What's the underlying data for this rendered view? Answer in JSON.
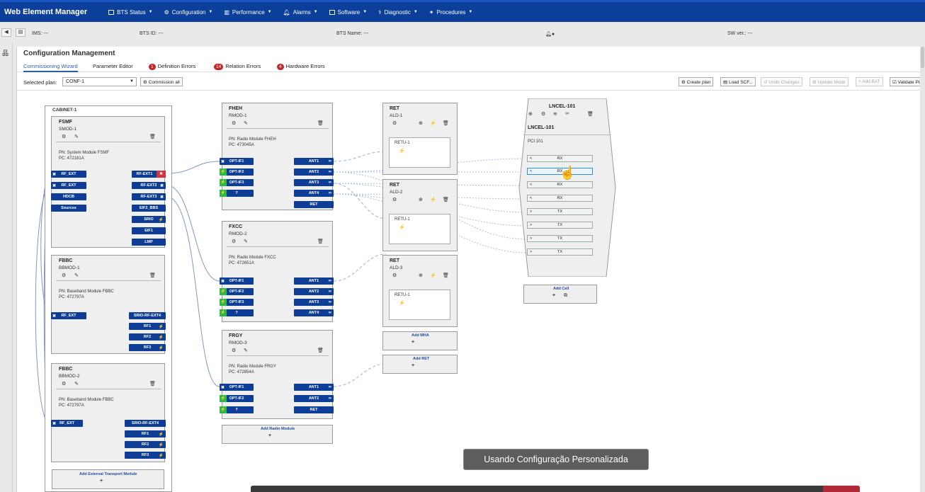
{
  "app": {
    "title": "Web Element Manager"
  },
  "menu": [
    {
      "label": "BTS Status",
      "icon": "bars-icon"
    },
    {
      "label": "Configuration",
      "icon": "gear-icon"
    },
    {
      "label": "Performance",
      "icon": "chart-icon"
    },
    {
      "label": "Alarms",
      "icon": "bell-icon"
    },
    {
      "label": "Software",
      "icon": "drive-icon"
    },
    {
      "label": "Diagnostic",
      "icon": "stethoscope-icon"
    },
    {
      "label": "Procedures",
      "icon": "wrench-icon"
    }
  ],
  "info": {
    "ims": "IMS: ---",
    "bts_id": "BTS ID: ---",
    "bts_name": "BTS Name: ---",
    "sw_ver": "SW ver.: ---"
  },
  "page": {
    "title": "Configuration Management"
  },
  "tabs": {
    "wizard": "Commissioning Wizard",
    "param": "Parameter Editor",
    "def_count": "1",
    "def": "Definition Errors",
    "rel_count": "14",
    "rel": "Relation Errors",
    "hw_count": "4",
    "hw": "Hardware Errors"
  },
  "plan": {
    "label": "Selected plan:",
    "value": "CONF-1",
    "commission": "Commission all",
    "create": "Create plan",
    "load": "Load SCF...",
    "undo": "Undo Changes",
    "update": "Update Mode",
    "add_bat": "+ Add BAT",
    "validate": "Validate Plan"
  },
  "cabinet": {
    "label": "CABINET-1",
    "fsmf": {
      "title": "FSMF",
      "id": "SMOD-1",
      "pn": "PN:   System Module FSMF",
      "pc": "PC:   472181A",
      "left_ports": [
        "RF_EXT",
        "RF_EXT",
        "HDCB",
        "Sources"
      ],
      "right_ports": [
        "RF-EXT1",
        "RF-EXT2",
        "RF-EXT3",
        "EIF2_BBS",
        "SRIO",
        "EIF1",
        "LMP"
      ]
    },
    "fbbc1": {
      "title": "FBBC",
      "id": "BBMOD-1",
      "pn": "PN:   Baseband Module FBBC",
      "pc": "PC:   472797A",
      "left_ports": [
        "RF_EXT"
      ],
      "right_ports": [
        "SRIO-RF-EXT4",
        "RF1",
        "RF2",
        "RF3"
      ]
    },
    "fbbc2": {
      "title": "FBBC",
      "id": "BBMOD-2",
      "pn": "PN:   Baseband Module FBBC",
      "pc": "PC:   472797A",
      "left_ports": [
        "RF_EXT"
      ],
      "right_ports": [
        "SRIO-RF-EXT4",
        "RF1",
        "RF2",
        "RF3"
      ]
    },
    "add_transport": "Add External Transport Module"
  },
  "radios": [
    {
      "title": "FHEH",
      "id": "RMOD-1",
      "pn": "PN:   Radio Module FHEH",
      "pc": "PC:   473045A",
      "left": [
        "OPT-IF1",
        "OPT-IF2",
        "OPT-IF3",
        "?"
      ],
      "right": [
        "ANT1",
        "ANT2",
        "ANT3",
        "ANT4",
        "RET"
      ]
    },
    {
      "title": "FXCC",
      "id": "RMOD-2",
      "pn": "PN:   Radio Module FXCC",
      "pc": "PC:   472651A",
      "left": [
        "OPT-IF1",
        "OPT-IF2",
        "OPT-IF3",
        "?"
      ],
      "right": [
        "ANT1",
        "ANT2",
        "ANT3",
        "ANT4"
      ]
    },
    {
      "title": "FRGY",
      "id": "RMOD-3",
      "pn": "PN:   Radio Module FRGY",
      "pc": "PC:   472854A",
      "left": [
        "OPT-IF1",
        "OPT-IF2",
        "?"
      ],
      "right": [
        "ANT1",
        "ANT2",
        "RET"
      ]
    }
  ],
  "add_radio": "Add Radio Module",
  "rets": [
    {
      "title": "RET",
      "id": "ALD-1",
      "unit": "RETU-1"
    },
    {
      "title": "RET",
      "id": "ALD-2",
      "unit": "RETU-1"
    },
    {
      "title": "RET",
      "id": "ALD-3",
      "unit": "RETU-1"
    }
  ],
  "add_mha": "Add MHA",
  "add_ret": "Add RET",
  "cell": {
    "title": "LNCEL-101",
    "name": "LNCEL-101",
    "pci": "PCI 101",
    "ports": [
      "RX",
      "RX",
      "RX",
      "RX",
      "TX",
      "TX",
      "TX",
      "TX"
    ]
  },
  "add_cell": "Add Cell",
  "toast": "Usando Configuração Personalizada"
}
